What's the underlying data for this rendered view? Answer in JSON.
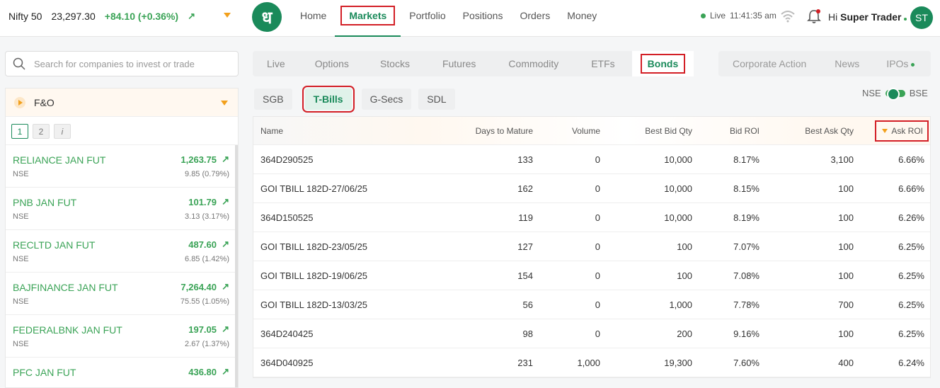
{
  "header": {
    "index_name": "Nifty 50",
    "index_value": "23,297.30",
    "index_change": "+84.10 (+0.36%)",
    "logo_glyph": "ध",
    "nav": [
      "Home",
      "Markets",
      "Portfolio",
      "Positions",
      "Orders",
      "Money"
    ],
    "active_nav": "Markets",
    "status_label": "Live",
    "status_time": "11:41:35 am",
    "greeting": "Hi",
    "user_name": "Super Trader",
    "avatar_initials": "ST"
  },
  "search": {
    "placeholder": "Search for companies to invest or trade"
  },
  "fo_panel": {
    "title": "F&O",
    "pages": [
      "1",
      "2",
      "i"
    ],
    "items": [
      {
        "symbol": "RELIANCE JAN FUT",
        "exchange": "NSE",
        "ltp": "1,263.75",
        "change": "9.85 (0.79%)"
      },
      {
        "symbol": "PNB JAN FUT",
        "exchange": "NSE",
        "ltp": "101.79",
        "change": "3.13 (3.17%)"
      },
      {
        "symbol": "RECLTD JAN FUT",
        "exchange": "NSE",
        "ltp": "487.60",
        "change": "6.85 (1.42%)"
      },
      {
        "symbol": "BAJFINANCE JAN FUT",
        "exchange": "NSE",
        "ltp": "7,264.40",
        "change": "75.55 (1.05%)"
      },
      {
        "symbol": "FEDERALBNK JAN FUT",
        "exchange": "NSE",
        "ltp": "197.05",
        "change": "2.67 (1.37%)"
      },
      {
        "symbol": "PFC JAN FUT",
        "exchange": "NSE",
        "ltp": "436.80",
        "change": ""
      }
    ]
  },
  "market_tabs": [
    "Live",
    "Options",
    "Stocks",
    "Futures",
    "Commodity",
    "ETFs",
    "Bonds"
  ],
  "active_market_tab": "Bonds",
  "secondary_tabs": [
    "Corporate Action",
    "News",
    "IPOs"
  ],
  "bond_tabs": [
    "SGB",
    "T-Bills",
    "G-Secs",
    "SDL"
  ],
  "active_bond_tab": "T-Bills",
  "exchange_toggle": {
    "left": "NSE",
    "right": "BSE"
  },
  "table": {
    "columns": [
      "Name",
      "Days to Mature",
      "Volume",
      "Best Bid Qty",
      "Bid ROI",
      "Best Ask Qty",
      "Ask ROI"
    ],
    "rows": [
      [
        "364D290525",
        "133",
        "0",
        "10,000",
        "8.17%",
        "3,100",
        "6.66%"
      ],
      [
        "GOI TBILL 182D-27/06/25",
        "162",
        "0",
        "10,000",
        "8.15%",
        "100",
        "6.66%"
      ],
      [
        "364D150525",
        "119",
        "0",
        "10,000",
        "8.19%",
        "100",
        "6.26%"
      ],
      [
        "GOI TBILL 182D-23/05/25",
        "127",
        "0",
        "100",
        "7.07%",
        "100",
        "6.25%"
      ],
      [
        "GOI TBILL 182D-19/06/25",
        "154",
        "0",
        "100",
        "7.08%",
        "100",
        "6.25%"
      ],
      [
        "GOI TBILL 182D-13/03/25",
        "56",
        "0",
        "1,000",
        "7.78%",
        "700",
        "6.25%"
      ],
      [
        "364D240425",
        "98",
        "0",
        "200",
        "9.16%",
        "100",
        "6.25%"
      ],
      [
        "364D040925",
        "231",
        "1,000",
        "19,300",
        "7.60%",
        "400",
        "6.24%"
      ]
    ]
  }
}
